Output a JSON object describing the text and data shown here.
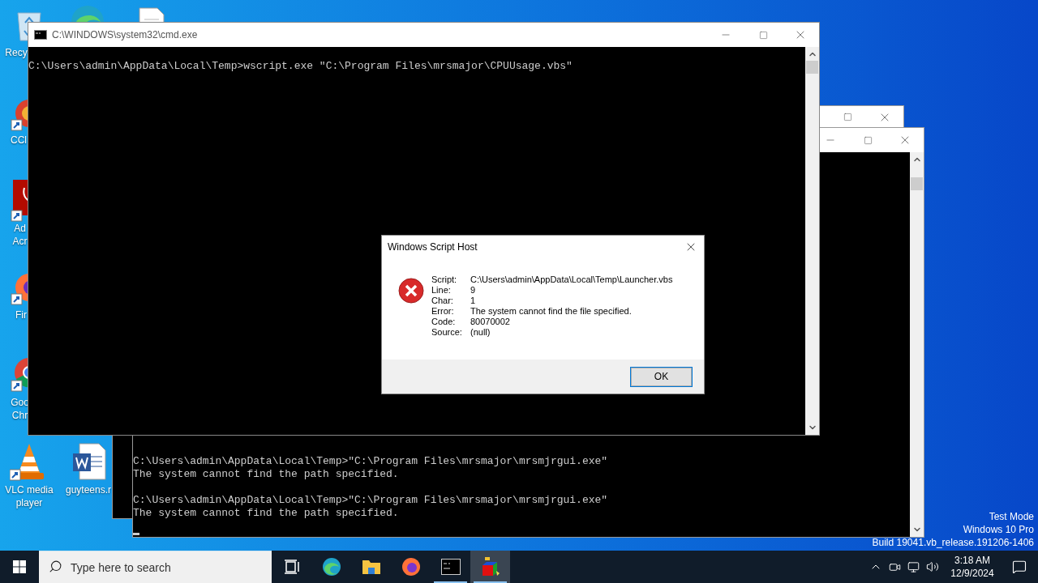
{
  "desktop_icons": [
    {
      "kind": "recycle",
      "label_lines": [
        "Recy"
      ]
    },
    {
      "kind": "edge"
    },
    {
      "kind": "document"
    },
    {
      "kind": "ccleaner",
      "label_lines": [
        "CCl"
      ]
    },
    {
      "kind": "acrobat",
      "label_lines": [
        "Ad",
        "Acr"
      ]
    },
    {
      "kind": "firefox",
      "label_lines": [
        "Fir"
      ]
    },
    {
      "kind": "chrome",
      "label_lines": [
        "Goo",
        "Chr"
      ]
    },
    {
      "kind": "vlc",
      "label_lines": [
        "VLC media",
        "player"
      ]
    },
    {
      "kind": "word",
      "label_lines": [
        "guyteens.r"
      ]
    }
  ],
  "back_console": {
    "blocks": [
      {
        "lines": [
          "C:\\Users\\admin\\AppData\\Local\\Temp>\"C:\\Program Files\\mrsmajor\\mrsmjrgui.exe\"",
          "The system cannot find the path specified."
        ]
      },
      {
        "lines": [
          "C:\\Users\\admin\\AppData\\Local\\Temp>\"C:\\Program Files\\mrsmajor\\mrsmjrgui.exe\"",
          "The system cannot find the path specified."
        ]
      }
    ]
  },
  "front_console": {
    "title": "C:\\WINDOWS\\system32\\cmd.exe",
    "lines": [
      "C:\\Users\\admin\\AppData\\Local\\Temp>wscript.exe \"C:\\Program Files\\mrsmajor\\CPUUsage.vbs\""
    ]
  },
  "dialog": {
    "title": "Windows Script Host",
    "fields": [
      {
        "label": "Script:",
        "value": "C:\\Users\\admin\\AppData\\Local\\Temp\\Launcher.vbs"
      },
      {
        "label": "Line:",
        "value": "9"
      },
      {
        "label": "Char:",
        "value": "1"
      },
      {
        "label": "Error:",
        "value": "The system cannot find the file specified."
      },
      {
        "label": "Code:",
        "value": "80070002"
      },
      {
        "label": "Source:",
        "value": "(null)"
      }
    ],
    "button": "OK"
  },
  "watermark": [
    "Test Mode",
    "Windows 10 Pro",
    "Build 19041.vb_release.191206-1406"
  ],
  "taskbar": {
    "search": {
      "placeholder": "Type here to search"
    },
    "apps": [
      {
        "kind": "taskview",
        "running": false,
        "selected": false
      },
      {
        "kind": "edge",
        "running": false,
        "selected": false
      },
      {
        "kind": "explorer",
        "running": false,
        "selected": false
      },
      {
        "kind": "firefox",
        "running": false,
        "selected": false
      },
      {
        "kind": "console",
        "running": true,
        "selected": false
      },
      {
        "kind": "cube",
        "running": true,
        "selected": true
      }
    ],
    "time": "3:18 AM",
    "date": "12/9/2024"
  }
}
